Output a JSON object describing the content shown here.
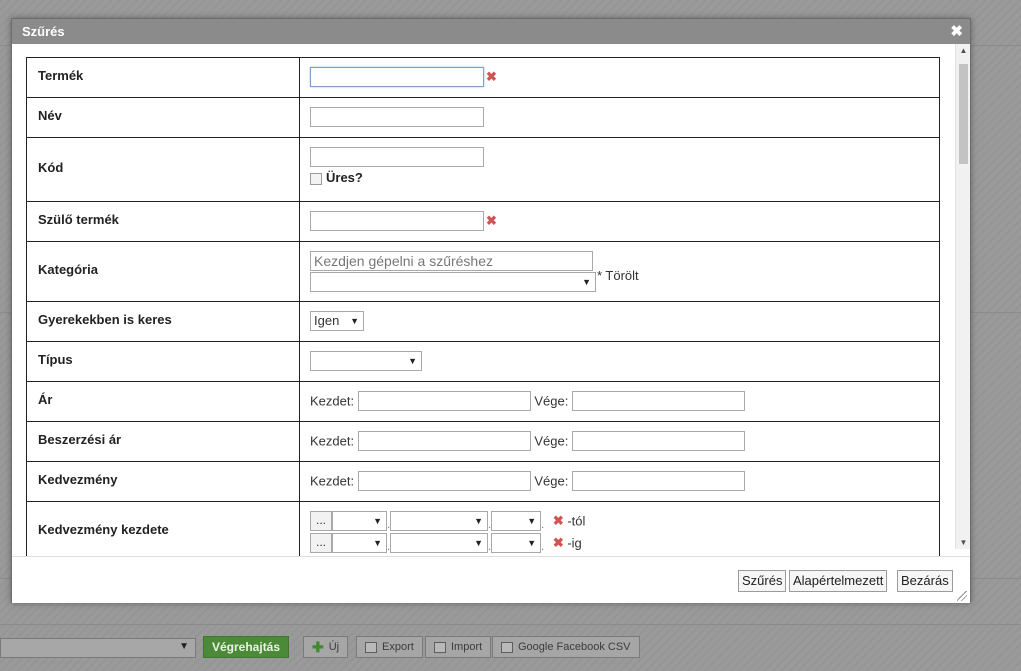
{
  "dialog": {
    "title": "Szűrés",
    "close_glyph": "✖"
  },
  "rows": {
    "termek": {
      "label": "Termék"
    },
    "nev": {
      "label": "Név"
    },
    "kod": {
      "label": "Kód",
      "empty_label": "Üres?"
    },
    "szulo": {
      "label": "Szülő termék"
    },
    "kategoria": {
      "label": "Kategória",
      "placeholder": "Kezdjen gépelni a szűréshez",
      "deleted_label": "* Törölt"
    },
    "gyerek": {
      "label": "Gyerekekben is keres",
      "selected": "Igen"
    },
    "tipus": {
      "label": "Típus",
      "selected": ""
    },
    "ar": {
      "label": "Ár",
      "start_label": "Kezdet:",
      "end_label": "Vége:"
    },
    "beszerzesi": {
      "label": "Beszerzési ár",
      "start_label": "Kezdet:",
      "end_label": "Vége:"
    },
    "kedvezmeny": {
      "label": "Kedvezmény",
      "start_label": "Kezdet:",
      "end_label": "Vége:"
    },
    "kedv_kezdete": {
      "label": "Kedvezmény kezdete",
      "dots": "...",
      "from_label": "-tól",
      "to_label": "-ig"
    }
  },
  "footer": {
    "filter_button": "Szűrés",
    "default_button": "Alapértelmezett",
    "close_button": "Bezárás"
  },
  "background": {
    "execute_button": "Végrehajtás",
    "new_button": "Új",
    "export_button": "Export",
    "import_button": "Import",
    "gfb_button": "Google Facebook CSV"
  },
  "icons": {
    "clear": "clear-x-icon",
    "close": "close-icon",
    "select": "chevron-down-icon"
  },
  "colors": {
    "titlebar": "#8b8b8b",
    "clear_x": "#d05454",
    "execute_green": "#4c8a3a"
  }
}
